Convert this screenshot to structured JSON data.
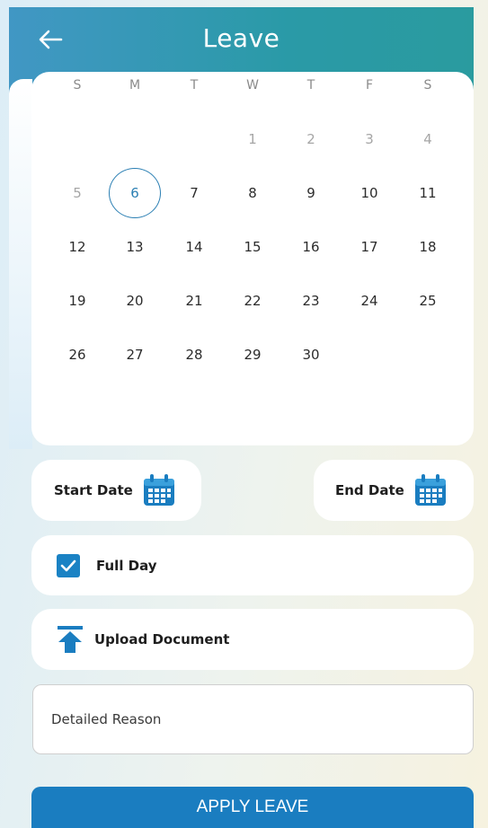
{
  "header": {
    "title": "Leave",
    "back_icon": "arrow-left-icon",
    "gradient_start": "#4197c4",
    "gradient_end": "#2a9b9f"
  },
  "calendar": {
    "weekdays": [
      "S",
      "M",
      "T",
      "W",
      "T",
      "F",
      "S"
    ],
    "weeks": [
      [
        null,
        null,
        null,
        "1",
        "2",
        "3",
        "4"
      ],
      [
        "5",
        "6",
        "7",
        "8",
        "9",
        "10",
        "11"
      ],
      [
        "12",
        "13",
        "14",
        "15",
        "16",
        "17",
        "18"
      ],
      [
        "19",
        "20",
        "21",
        "22",
        "23",
        "24",
        "25"
      ],
      [
        "26",
        "27",
        "28",
        "29",
        "30",
        null,
        null
      ]
    ],
    "muted_days": [
      "1",
      "2",
      "3",
      "4",
      "5"
    ],
    "today": "6",
    "today_color": "#2b7fb3"
  },
  "start_date": {
    "label": "Start Date",
    "icon": "calendar-icon"
  },
  "end_date": {
    "label": "End Date",
    "icon": "calendar-icon"
  },
  "full_day": {
    "label": "Full Day",
    "checked": true,
    "checkbox_color": "#1a82c4"
  },
  "upload": {
    "label": "Upload Document",
    "icon": "upload-icon"
  },
  "reason": {
    "placeholder": "Detailed Reason"
  },
  "apply": {
    "label": "APPLY LEAVE",
    "color": "#1a7dc0"
  }
}
